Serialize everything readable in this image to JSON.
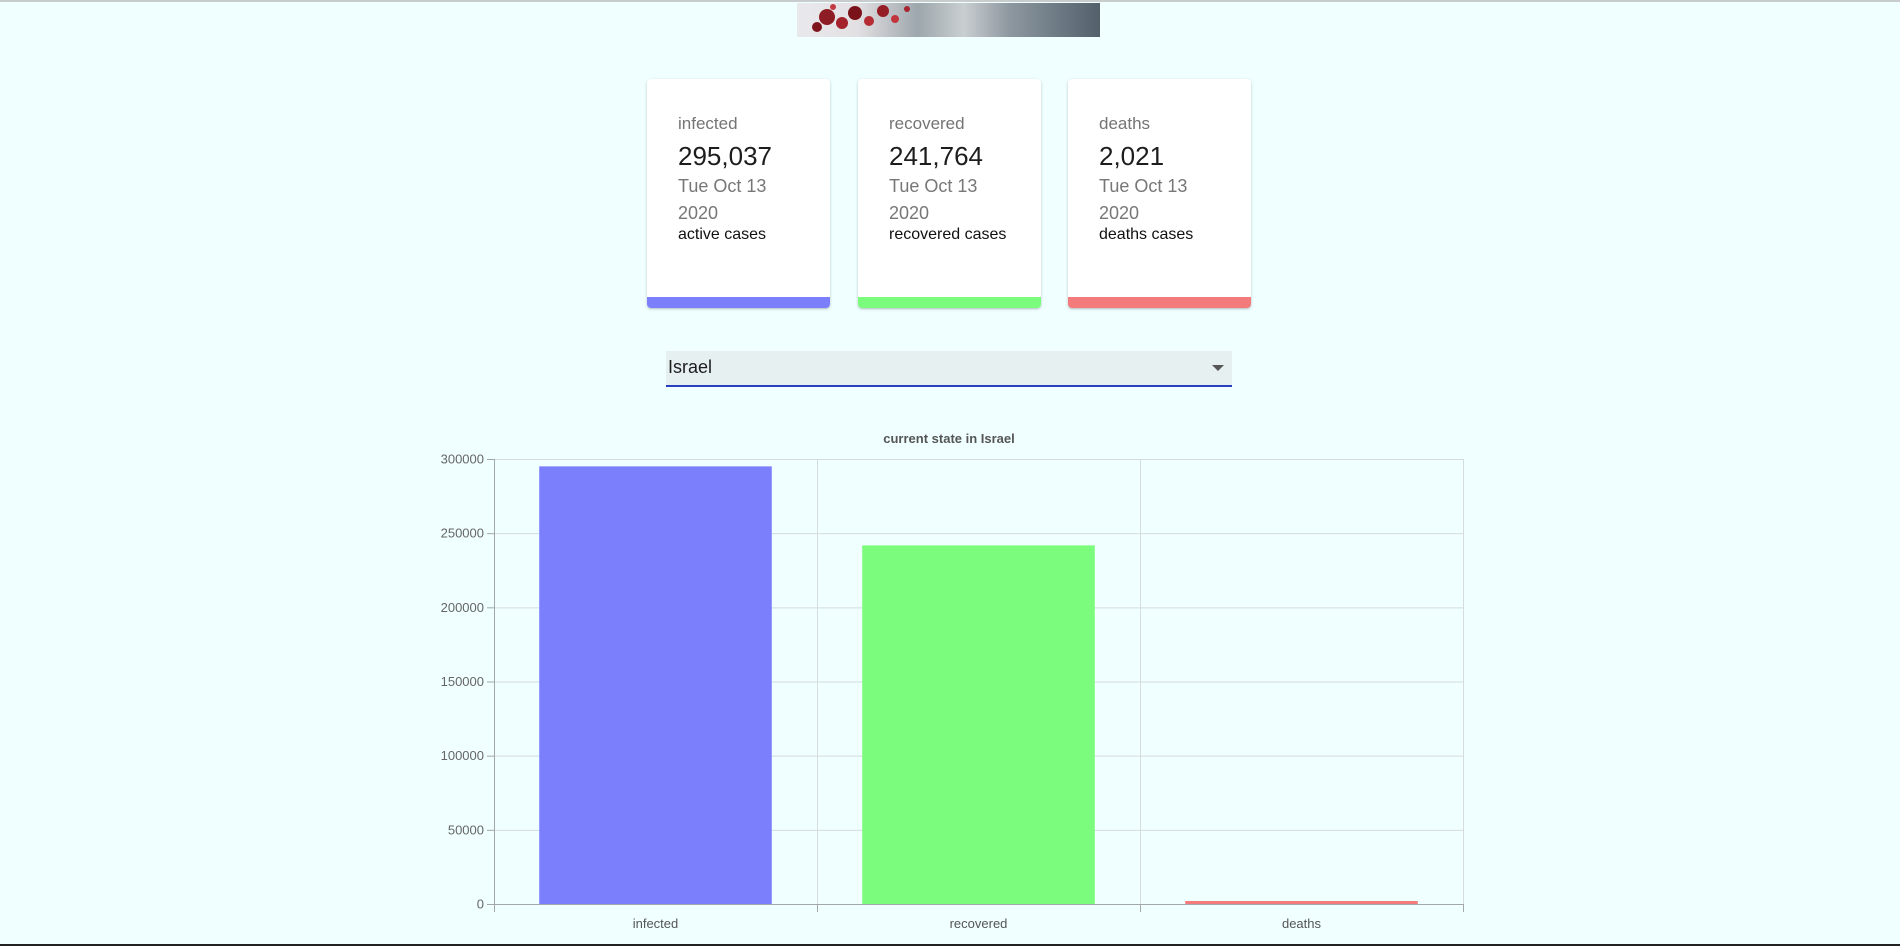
{
  "stats": [
    {
      "title": "infected",
      "value": "295,037",
      "date": "Tue Oct 13 2020",
      "caption": "active cases",
      "color": "#7b7ffc"
    },
    {
      "title": "recovered",
      "value": "241,764",
      "date": "Tue Oct 13 2020",
      "caption": "recovered cases",
      "color": "#7cfc7c"
    },
    {
      "title": "deaths",
      "value": "2,021",
      "date": "Tue Oct 13 2020",
      "caption": "deaths cases",
      "color": "#f37b7b"
    }
  ],
  "country_select": {
    "selected": "Israel"
  },
  "chart_data": {
    "type": "bar",
    "title": "current state in Israel",
    "categories": [
      "infected",
      "recovered",
      "deaths"
    ],
    "values": [
      295037,
      241764,
      2021
    ],
    "colors": [
      "#7b7ffc",
      "#7cfc7c",
      "#f37b7b"
    ],
    "ylim": [
      0,
      300000
    ],
    "yticks": [
      0,
      50000,
      100000,
      150000,
      200000,
      250000,
      300000
    ],
    "ytick_labels": [
      "0",
      "50000",
      "100000",
      "150000",
      "200000",
      "250000",
      "300000"
    ],
    "grid": true,
    "legend": "none"
  }
}
